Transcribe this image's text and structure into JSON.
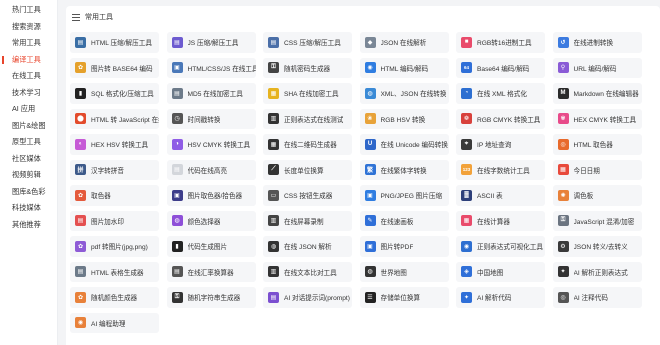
{
  "sidebar": {
    "items": [
      {
        "label": "热门工具"
      },
      {
        "label": "搜索资源"
      },
      {
        "label": "常用工具"
      },
      {
        "label": "编译工具",
        "active": true
      },
      {
        "label": "在线工具"
      },
      {
        "label": "技术学习"
      },
      {
        "label": "AI 应用"
      },
      {
        "label": "图片&绘图"
      },
      {
        "label": "原型工具"
      },
      {
        "label": "社区媒体"
      },
      {
        "label": "视频剪辑"
      },
      {
        "label": "图库&色彩"
      },
      {
        "label": "科技媒体"
      },
      {
        "label": "其他推荐"
      }
    ]
  },
  "section": {
    "title": "常用工具"
  },
  "tools": [
    {
      "label": "HTML 压缩/解压工具",
      "icon": "html-compress-icon",
      "color": "#3a6ea5",
      "glyph": "▤"
    },
    {
      "label": "JS 压缩/解压工具",
      "icon": "js-compress-icon",
      "color": "#6d5bd0",
      "glyph": "▤"
    },
    {
      "label": "CSS 压缩/解压工具",
      "icon": "css-compress-icon",
      "color": "#4b6fa8",
      "glyph": "▤"
    },
    {
      "label": "JSON 在线解析",
      "icon": "json-parse-icon",
      "color": "#7a8796",
      "glyph": "◆"
    },
    {
      "label": "RGB转16进制工具",
      "icon": "rgb-hex-icon",
      "color": "#e94b6b",
      "glyph": "■"
    },
    {
      "label": "在线进制转换",
      "icon": "radix-convert-icon",
      "color": "#3c7be0",
      "glyph": "↺"
    },
    {
      "label": "图片转 BASE64 编码",
      "icon": "image-base64-icon",
      "color": "#e5a12b",
      "glyph": "✿"
    },
    {
      "label": "HTML/CSS/JS 在线工具",
      "icon": "html-css-js-icon",
      "color": "#4a78b8",
      "glyph": "▣"
    },
    {
      "label": "随机密码生成器",
      "icon": "password-generator-icon",
      "color": "#444444",
      "glyph": "⚿"
    },
    {
      "label": "HTML 编码/解码",
      "icon": "html-encode-icon",
      "color": "#2f7de1",
      "glyph": "◉"
    },
    {
      "label": "Base64 编码/解码",
      "icon": "base64-icon",
      "color": "#2f6fd8",
      "glyph": "64"
    },
    {
      "label": "URL 编码/解码",
      "icon": "url-encode-icon",
      "color": "#8a5bd6",
      "glyph": "⚲"
    },
    {
      "label": "SQL 格式化/压缩工具",
      "icon": "sql-format-icon",
      "color": "#222222",
      "glyph": "▮"
    },
    {
      "label": "MD5 在线加密工具",
      "icon": "md5-icon",
      "color": "#6c7a89",
      "glyph": "▤"
    },
    {
      "label": "SHA 在线加密工具",
      "icon": "sha-icon",
      "color": "#e6b320",
      "glyph": "▦"
    },
    {
      "label": "XML、JSON 在线转换",
      "icon": "xml-json-icon",
      "color": "#3a8ad6",
      "glyph": "◍"
    },
    {
      "label": "在线 XML 格式化",
      "icon": "xml-format-icon",
      "color": "#2d6fd1",
      "glyph": "◔"
    },
    {
      "label": "Markdown 在线编辑器",
      "icon": "markdown-icon",
      "color": "#2b2b2b",
      "glyph": "M"
    },
    {
      "label": "HTML 转 JavaScript 在线",
      "icon": "html-to-js-icon",
      "color": "#e34b2c",
      "glyph": "⬤"
    },
    {
      "label": "时间戳转换",
      "icon": "timestamp-icon",
      "color": "#555555",
      "glyph": "◷"
    },
    {
      "label": "正则表达式在线测试",
      "icon": "regex-test-icon",
      "color": "#333333",
      "glyph": "▥"
    },
    {
      "label": "RGB HSV 转换",
      "icon": "rgb-hsv-icon",
      "color": "#e8a33a",
      "glyph": "❀"
    },
    {
      "label": "RGB CMYK 转换工具",
      "icon": "rgb-cmyk-icon",
      "color": "#d8413c",
      "glyph": "❁"
    },
    {
      "label": "HEX CMYK 转换工具",
      "icon": "hex-cmyk-icon",
      "color": "#e84b8a",
      "glyph": "✾"
    },
    {
      "label": "HEX HSV 转换工具",
      "icon": "hex-hsv-icon",
      "color": "#c65bd6",
      "glyph": "◐"
    },
    {
      "label": "HSV CMYK 转换工具",
      "icon": "hsv-cmyk-icon",
      "color": "#8f5ce6",
      "glyph": "◑"
    },
    {
      "label": "在线二维码生成器",
      "icon": "qrcode-icon",
      "color": "#333333",
      "glyph": "▦"
    },
    {
      "label": "在线 Unicode 编码转换",
      "icon": "unicode-icon",
      "color": "#2d66c9",
      "glyph": "U"
    },
    {
      "label": "IP 地址查询",
      "icon": "ip-lookup-icon",
      "color": "#3a3a3a",
      "glyph": "⌖"
    },
    {
      "label": "HTML 取色器",
      "icon": "html-color-picker-icon",
      "color": "#e86a2c",
      "glyph": "◎"
    },
    {
      "label": "汉字转拼音",
      "icon": "pinyin-icon",
      "color": "#3d5a8a",
      "glyph": "拼"
    },
    {
      "label": "代码在线高亮",
      "icon": "code-highlight-icon",
      "color": "#d3d6db",
      "glyph": "▤"
    },
    {
      "label": "长度单位换算",
      "icon": "length-unit-icon",
      "color": "#333333",
      "glyph": "⟋"
    },
    {
      "label": "在线繁体字转换",
      "icon": "traditional-chinese-icon",
      "color": "#2f73d6",
      "glyph": "繁"
    },
    {
      "label": "在线字数统计工具",
      "icon": "word-count-icon",
      "color": "#f2a23a",
      "glyph": "123"
    },
    {
      "label": "今日日期",
      "icon": "calendar-icon",
      "color": "#e84a3c",
      "glyph": "▦"
    },
    {
      "label": "取色器",
      "icon": "color-picker-icon",
      "color": "#e45a3c",
      "glyph": "✿"
    },
    {
      "label": "图片取色器/拾色器",
      "icon": "image-color-picker-icon",
      "color": "#3d3d8a",
      "glyph": "▣"
    },
    {
      "label": "CSS 按钮生成器",
      "icon": "css-button-icon",
      "color": "#555555",
      "glyph": "▭"
    },
    {
      "label": "PNG/JPEG 图片压缩",
      "icon": "image-compress-icon",
      "color": "#2f7de1",
      "glyph": "▣"
    },
    {
      "label": "ASCII 表",
      "icon": "ascii-table-icon",
      "color": "#2d3f7a",
      "glyph": "▓"
    },
    {
      "label": "调色板",
      "icon": "palette-icon",
      "color": "#e8813a",
      "glyph": "✺"
    },
    {
      "label": "图片加水印",
      "icon": "watermark-icon",
      "color": "#e45050",
      "glyph": "▤"
    },
    {
      "label": "颜色选择器",
      "icon": "color-selector-icon",
      "color": "#8e4fd8",
      "glyph": "◍"
    },
    {
      "label": "在线屏幕录制",
      "icon": "screen-record-icon",
      "color": "#444444",
      "glyph": "▥"
    },
    {
      "label": "在线速画板",
      "icon": "sketch-board-icon",
      "color": "#2f6fd8",
      "glyph": "✎"
    },
    {
      "label": "在线计算器",
      "icon": "calculator-icon",
      "color": "#e94b6b",
      "glyph": "▦"
    },
    {
      "label": "JavaScript 混淆/加密",
      "icon": "js-obfuscate-icon",
      "color": "#6b7480",
      "glyph": "⚿"
    },
    {
      "label": "pdf 转图片(jpg,png)",
      "icon": "pdf-to-image-icon",
      "color": "#8e5bd6",
      "glyph": "✿"
    },
    {
      "label": "代码生成图片",
      "icon": "code-image-icon",
      "color": "#222222",
      "glyph": "▮"
    },
    {
      "label": "在线 JSON 解析",
      "icon": "online-json-icon",
      "color": "#333333",
      "glyph": "◍"
    },
    {
      "label": "图片转PDF",
      "icon": "image-to-pdf-icon",
      "color": "#2f6fd8",
      "glyph": "▣"
    },
    {
      "label": "正则表达式可视化工具",
      "icon": "regex-visual-icon",
      "color": "#2d6fd1",
      "glyph": "◉"
    },
    {
      "label": "JSON 转义/去转义",
      "icon": "json-escape-icon",
      "color": "#3a3a3a",
      "glyph": "⚙"
    },
    {
      "label": "HTML 表格生成器",
      "icon": "html-table-icon",
      "color": "#6c7a89",
      "glyph": "▤"
    },
    {
      "label": "在线汇率换算器",
      "icon": "exchange-rate-icon",
      "color": "#555555",
      "glyph": "▤"
    },
    {
      "label": "在线文本比对工具",
      "icon": "text-diff-icon",
      "color": "#333333",
      "glyph": "▥"
    },
    {
      "label": "世界地图",
      "icon": "world-map-icon",
      "color": "#333333",
      "glyph": "◍"
    },
    {
      "label": "中国地图",
      "icon": "china-map-icon",
      "color": "#2f6fd8",
      "glyph": "◈"
    },
    {
      "label": "AI 解析正则表达式",
      "icon": "ai-regex-icon",
      "color": "#333333",
      "glyph": "✦"
    },
    {
      "label": "随机颜色生成器",
      "icon": "random-color-icon",
      "color": "#e8813a",
      "glyph": "✿"
    },
    {
      "label": "随机字符串生成器",
      "icon": "random-string-icon",
      "color": "#333333",
      "glyph": "⚿"
    },
    {
      "label": "AI 对话提示词(prompt)",
      "icon": "ai-prompt-icon",
      "color": "#7b4fd0",
      "glyph": "▤"
    },
    {
      "label": "存储单位换算",
      "icon": "storage-unit-icon",
      "color": "#222222",
      "glyph": "☰"
    },
    {
      "label": "AI 解析代码",
      "icon": "ai-code-parse-icon",
      "color": "#2f6fd8",
      "glyph": "✦"
    },
    {
      "label": "AI 注释代码",
      "icon": "ai-code-comment-icon",
      "color": "#555555",
      "glyph": "◎"
    },
    {
      "label": "AI 编程助理",
      "icon": "ai-coding-assistant-icon",
      "color": "#e8813a",
      "glyph": "◉"
    }
  ]
}
